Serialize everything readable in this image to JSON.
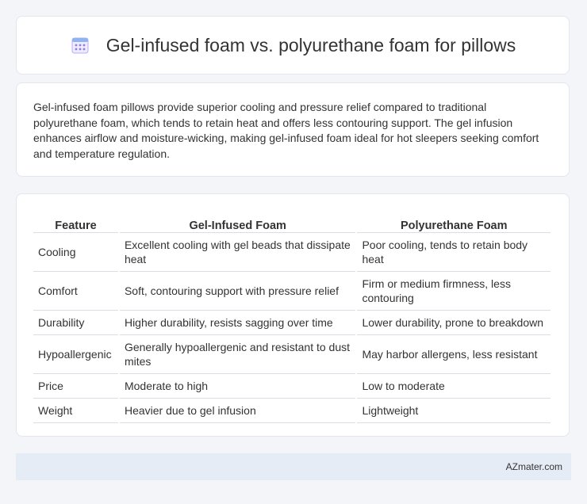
{
  "header": {
    "icon": "calendar-icon",
    "title": "Gel-infused foam vs. polyurethane foam for pillows"
  },
  "intro": {
    "text": "Gel-infused foam pillows provide superior cooling and pressure relief compared to traditional polyurethane foam, which tends to retain heat and offers less contouring support. The gel infusion enhances airflow and moisture-wicking, making gel-infused foam ideal for hot sleepers seeking comfort and temperature regulation."
  },
  "table": {
    "headers": [
      "Feature",
      "Gel-Infused Foam",
      "Polyurethane Foam"
    ],
    "rows": [
      [
        "Cooling",
        "Excellent cooling with gel beads that dissipate heat",
        "Poor cooling, tends to retain body heat"
      ],
      [
        "Comfort",
        "Soft, contouring support with pressure relief",
        "Firm or medium firmness, less contouring"
      ],
      [
        "Durability",
        "Higher durability, resists sagging over time",
        "Lower durability, prone to breakdown"
      ],
      [
        "Hypoallergenic",
        "Generally hypoallergenic and resistant to dust mites",
        "May harbor allergens, less resistant"
      ],
      [
        "Price",
        "Moderate to high",
        "Low to moderate"
      ],
      [
        "Weight",
        "Heavier due to gel infusion",
        "Lightweight"
      ]
    ]
  },
  "footer": {
    "text": "AZmater.com"
  },
  "colors": {
    "background": "#f3f5f9",
    "card": "#ffffff",
    "footer_bg": "#e6ecf5",
    "icon_accent": "#8b7fe0"
  }
}
